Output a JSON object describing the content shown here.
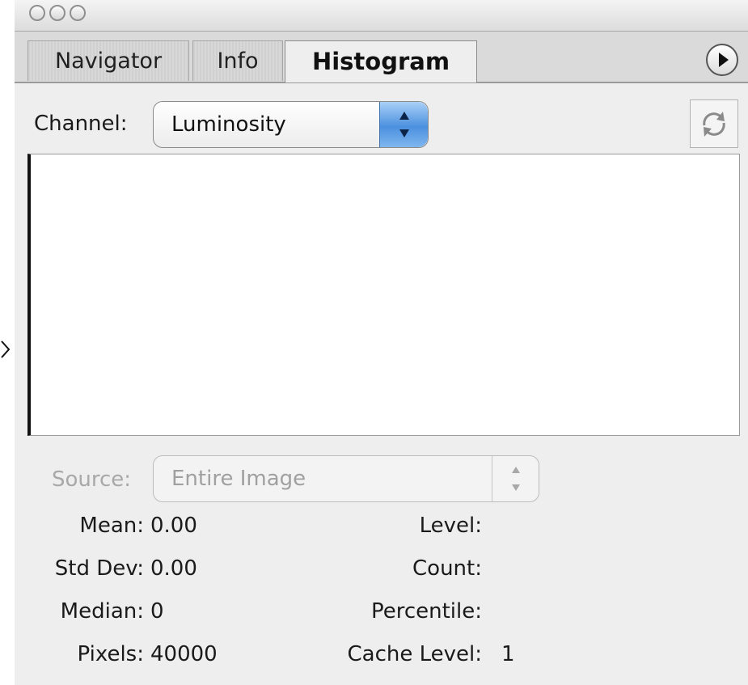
{
  "window": {
    "tabs": [
      "Navigator",
      "Info",
      "Histogram"
    ],
    "active_tab": "Histogram"
  },
  "channel": {
    "label": "Channel:",
    "value": "Luminosity"
  },
  "source": {
    "label": "Source:",
    "value": "Entire Image"
  },
  "stats": {
    "mean_label": "Mean:",
    "mean": "0.00",
    "stddev_label": "Std Dev:",
    "stddev": "0.00",
    "median_label": "Median:",
    "median": "0",
    "pixels_label": "Pixels:",
    "pixels": "40000",
    "level_label": "Level:",
    "level": "",
    "count_label": "Count:",
    "count": "",
    "percentile_label": "Percentile:",
    "percentile": "",
    "cache_label": "Cache Level:",
    "cache": "1"
  },
  "icons": {
    "panel_menu": "play-triangle-icon",
    "refresh": "refresh-icon",
    "stepper": "up-down-arrows-icon"
  },
  "colors": {
    "panel_bg": "#eeeeee",
    "stepper_blue": "#4b90df",
    "disabled_text": "#a8a8a8"
  }
}
